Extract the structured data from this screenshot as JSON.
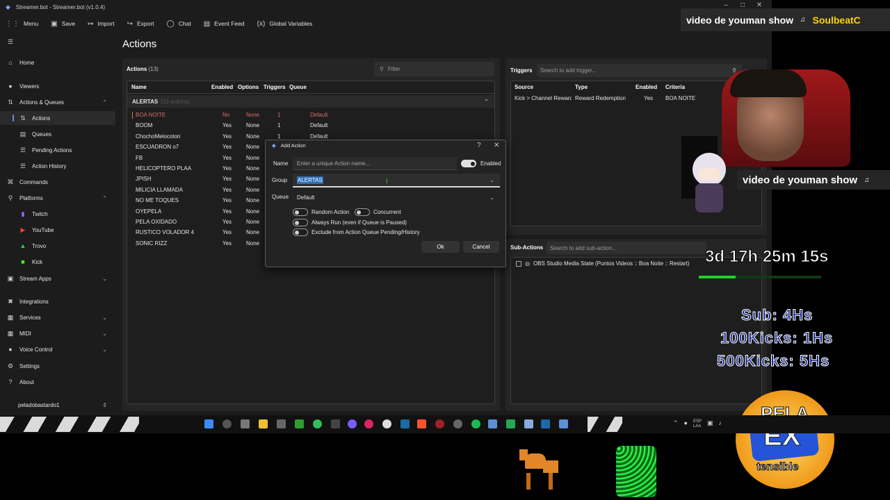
{
  "window": {
    "title": "Streamer.bot - Streamer.bot (v1.0.4)"
  },
  "toolbar": [
    {
      "icon": "menu-grid-icon",
      "label": "Menu"
    },
    {
      "icon": "save-icon",
      "label": "Save"
    },
    {
      "icon": "import-icon",
      "label": "Import"
    },
    {
      "icon": "export-icon",
      "label": "Export"
    },
    {
      "icon": "chat-icon",
      "label": "Chat"
    },
    {
      "icon": "event-feed-icon",
      "label": "Event Feed"
    },
    {
      "icon": "variables-icon",
      "label": "Global Variables"
    }
  ],
  "sidebar": {
    "items": [
      {
        "label": "Home",
        "icon": "home-icon"
      },
      {
        "label": "Viewers",
        "icon": "viewers-icon"
      },
      {
        "label": "Actions & Queues",
        "icon": "actions-icon"
      },
      {
        "label": "Actions"
      },
      {
        "label": "Queues"
      },
      {
        "label": "Pending Actions"
      },
      {
        "label": "Action History"
      },
      {
        "label": "Commands",
        "icon": "commands-icon"
      },
      {
        "label": "Platforms",
        "icon": "platforms-icon"
      },
      {
        "label": "Twitch"
      },
      {
        "label": "YouTube"
      },
      {
        "label": "Trovo"
      },
      {
        "label": "Kick"
      },
      {
        "label": "Stream Apps",
        "icon": "stream-apps-icon"
      },
      {
        "label": "Integrations",
        "icon": "integrations-icon"
      },
      {
        "label": "Services",
        "icon": "services-icon"
      },
      {
        "label": "MIDI",
        "icon": "midi-icon"
      },
      {
        "label": "Voice Control",
        "icon": "voice-icon"
      },
      {
        "label": "Settings",
        "icon": "settings-icon"
      },
      {
        "label": "About",
        "icon": "about-icon"
      }
    ],
    "user": "peladobastardo1"
  },
  "main": {
    "title": "Actions",
    "actions_label": "Actions",
    "actions_count": "(13)",
    "filter_placeholder": "Filter",
    "columns": [
      "Name",
      "Enabled",
      "Options",
      "Triggers",
      "Queue"
    ],
    "group": {
      "name": "ALERTAS",
      "count": "(13 actions)"
    },
    "rows": [
      {
        "name": "BOA NOITE",
        "enabled": "No",
        "options": "None",
        "triggers": "1",
        "queue": "Default",
        "disabled": true
      },
      {
        "name": "BOOM",
        "enabled": "Yes",
        "options": "None",
        "triggers": "1",
        "queue": "Default"
      },
      {
        "name": "ChochoMelocoton",
        "enabled": "Yes",
        "options": "None",
        "triggers": "1",
        "queue": "Default"
      },
      {
        "name": "ESCUADRON o7",
        "enabled": "Yes",
        "options": "None",
        "triggers": "",
        "queue": ""
      },
      {
        "name": "FB",
        "enabled": "Yes",
        "options": "None",
        "triggers": "",
        "queue": ""
      },
      {
        "name": "HELICOPTERO PLAA",
        "enabled": "Yes",
        "options": "None",
        "triggers": "",
        "queue": ""
      },
      {
        "name": "JPISH",
        "enabled": "Yes",
        "options": "None",
        "triggers": "",
        "queue": ""
      },
      {
        "name": "MILICIA LLAMADA",
        "enabled": "Yes",
        "options": "None",
        "triggers": "",
        "queue": ""
      },
      {
        "name": "NO ME TOQUES",
        "enabled": "Yes",
        "options": "None",
        "triggers": "",
        "queue": ""
      },
      {
        "name": "OYEPELA",
        "enabled": "Yes",
        "options": "None",
        "triggers": "",
        "queue": ""
      },
      {
        "name": "PELA OXIDADO",
        "enabled": "Yes",
        "options": "None",
        "triggers": "",
        "queue": ""
      },
      {
        "name": "RUSTICO VOLADOR 4",
        "enabled": "Yes",
        "options": "None",
        "triggers": "",
        "queue": ""
      },
      {
        "name": "SONIC RIZZ",
        "enabled": "Yes",
        "options": "None",
        "triggers": "",
        "queue": ""
      }
    ]
  },
  "triggers": {
    "title": "Triggers",
    "search_placeholder": "Search to add trigger...",
    "columns": [
      "Source",
      "Type",
      "Enabled",
      "Criteria"
    ],
    "row": {
      "source": "Kick > Channel Reward",
      "type": "Reward Redemption",
      "enabled": "Yes",
      "criteria": "BOA NOITE"
    }
  },
  "subactions": {
    "title": "Sub-Actions",
    "search_placeholder": "Search to add sub-action...",
    "item": "OBS Studio Media State (Puntos Videos :: Boa Noite :: Restart)"
  },
  "dialog": {
    "title": "Add Action",
    "help": "?",
    "close": "✕",
    "name_label": "Name",
    "name_placeholder": "Enter a unique Action name...",
    "enabled_label": "Enabled",
    "group_label": "Group",
    "group_value": "ALERTAS",
    "queue_label": "Queue",
    "queue_value": "Default",
    "random_label": "Random Action",
    "concurrent_label": "Concurrent",
    "always_run_label": "Always Run (even if Queue is Paused)",
    "exclude_label": "Exclude from Action Queue Pending/History",
    "ok_label": "Ok",
    "cancel_label": "Cancel"
  },
  "overlay": {
    "banner_top": "video de youman show",
    "banner_top_right": "SoulbeatC",
    "banner_mid": "video de youman show",
    "timer": "3d 17h 25m 15s",
    "timer_progress": 0.3,
    "goal_lines": [
      "Sub: 4Hs",
      "100Kicks: 1Hs",
      "500Kicks: 5Hs"
    ],
    "logo_top": "PELA",
    "logo_mid": "EX",
    "logo_bottom": "tensible"
  },
  "taskbar": {
    "lang": "ESP\nLAA"
  },
  "colors": {
    "accent": "#2f6db5",
    "disabled_row": "#d96b6b",
    "progress": "#1fd12a"
  }
}
